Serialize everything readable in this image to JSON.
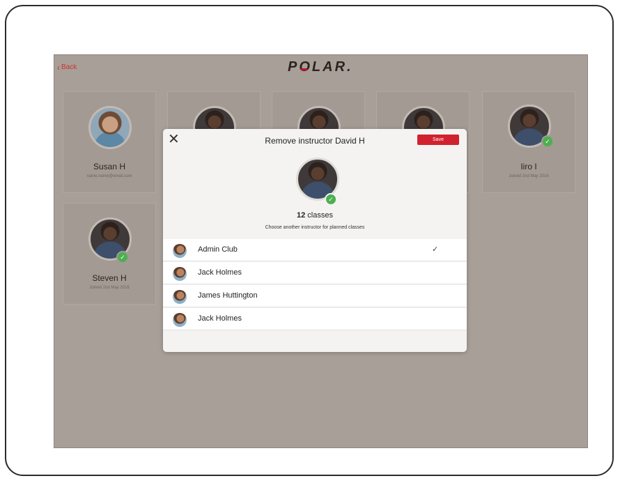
{
  "header": {
    "back_label": "Back",
    "brand": "POLAR"
  },
  "cards": [
    {
      "name": "Susan H",
      "sub": "name.name@email.com",
      "avatar": "female",
      "checked": false
    },
    {
      "name": "Iiro I",
      "sub": "Joined 2nd May 2016",
      "avatar": "male",
      "checked": true
    },
    {
      "name": "Steven H",
      "sub": "Joined 2nd May 2016",
      "avatar": "male",
      "checked": true
    }
  ],
  "modal": {
    "title": "Remove instructor David H",
    "save_label": "Save",
    "class_count": "12",
    "class_count_suffix": " classes",
    "subtitle": "Choose another instructor for planned classes",
    "instructors": [
      {
        "label": "Admin Club",
        "selected": true
      },
      {
        "label": "Jack Holmes",
        "selected": false
      },
      {
        "label": "James Huttington",
        "selected": false
      },
      {
        "label": "Jack Holmes",
        "selected": false
      }
    ]
  },
  "colors": {
    "accent": "#d0222e",
    "check": "#4caf50",
    "background": "#a89f98"
  },
  "icons": {
    "back": "chevron-left-icon",
    "close": "close-icon",
    "selected": "checkmark-icon"
  }
}
